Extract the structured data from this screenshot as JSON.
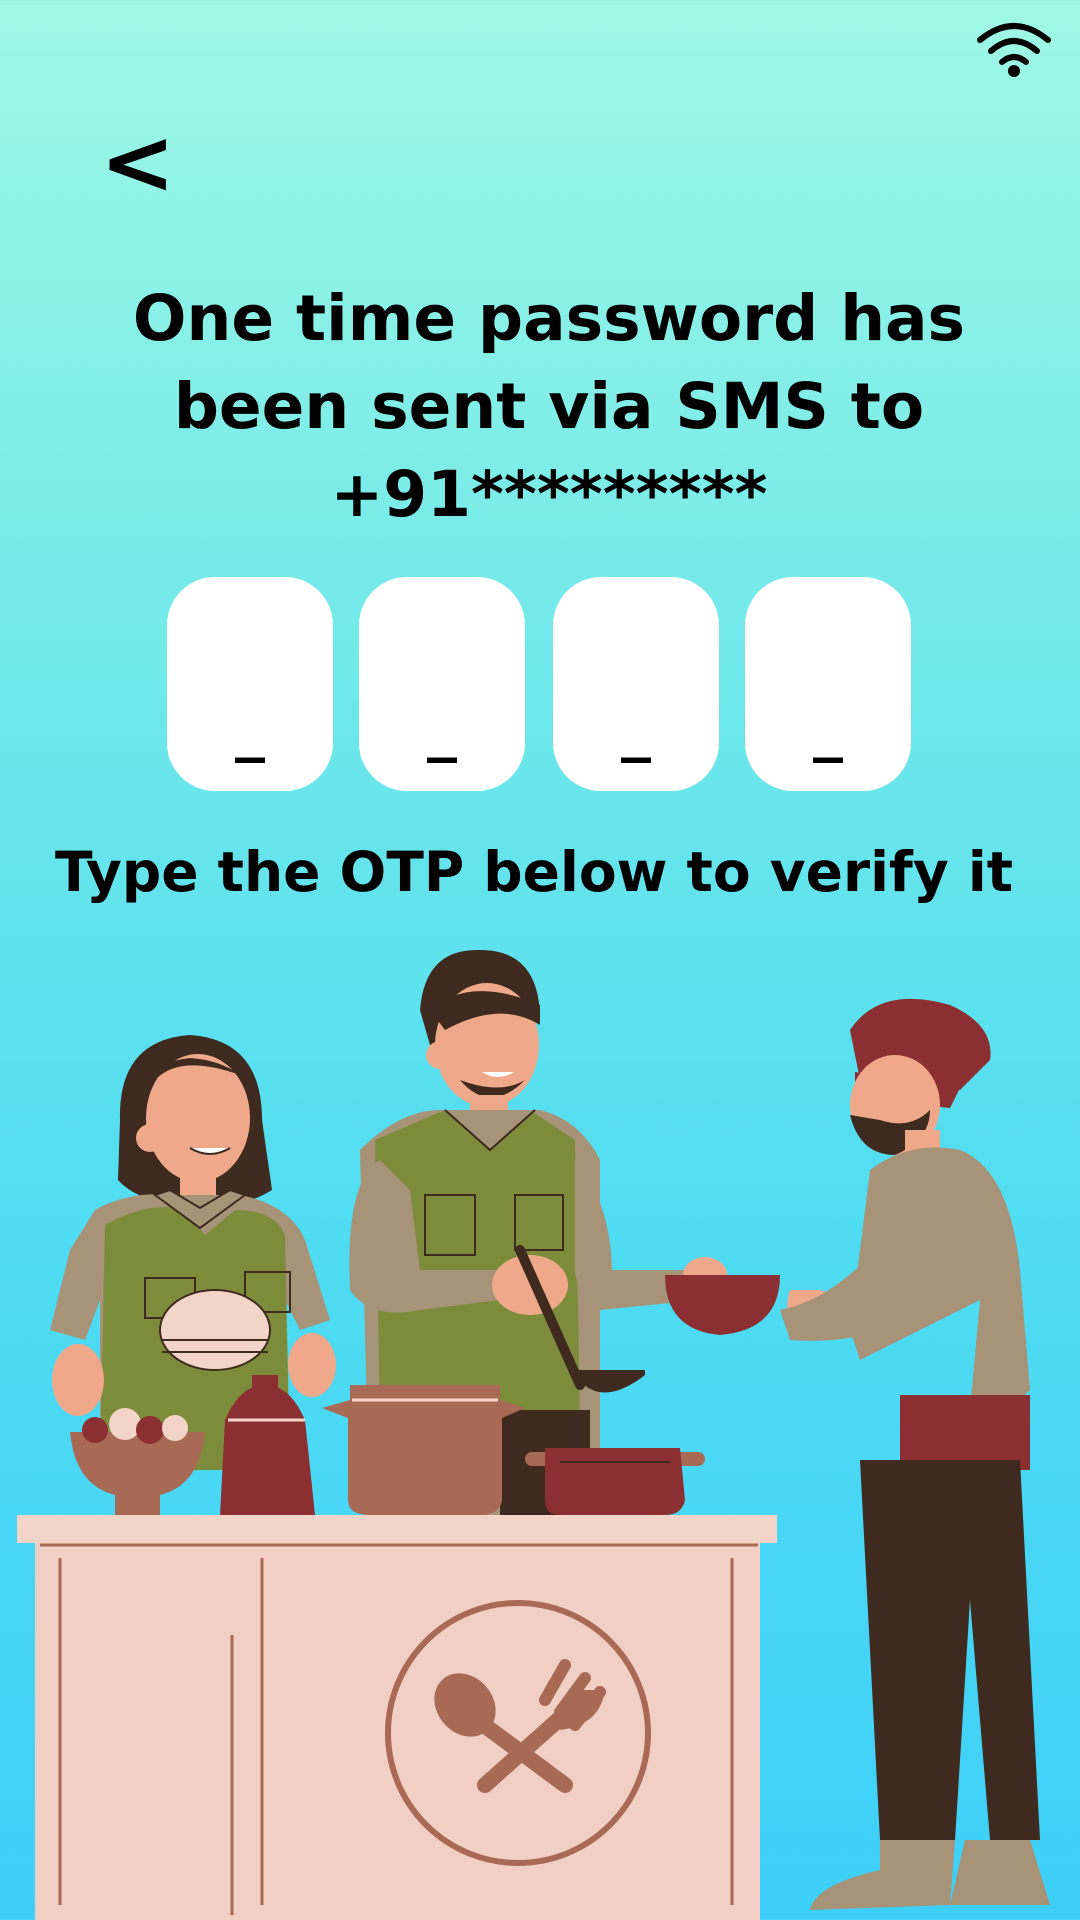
{
  "status_bar": {
    "wifi_icon": "wifi-icon"
  },
  "nav": {
    "back_label": "<"
  },
  "title": {
    "line1": "One time password has",
    "line2": "been sent via SMS to",
    "line3": "+91*********"
  },
  "otp": {
    "boxes": [
      {
        "value": "_"
      },
      {
        "value": "_"
      },
      {
        "value": "_"
      },
      {
        "value": "_"
      }
    ]
  },
  "hint": "Type the OTP below to verify it",
  "illustration": {
    "name": "volunteers-serving-food-illustration"
  },
  "colors": {
    "background_top": "#9ff8e4",
    "background_bottom": "#3ecff8",
    "box": "#ffffff",
    "text": "#000000",
    "counter": "#f2cfc4",
    "accent_red": "#8b2f32",
    "pot_brown": "#a86a55",
    "vest_green": "#7d8c3b"
  }
}
